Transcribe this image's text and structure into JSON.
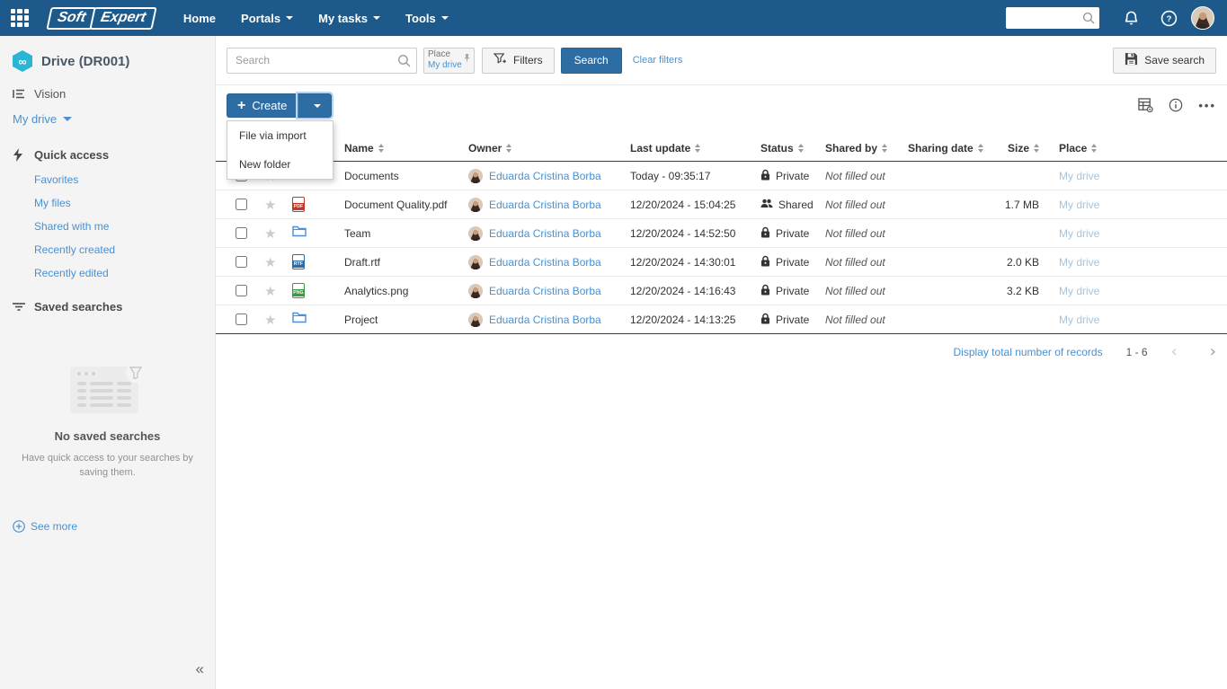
{
  "colors": {
    "navbar": "#1d5a8b",
    "primary": "#2e6da4",
    "link": "#4a90d2",
    "muted_place": "#a7c4dc",
    "pdf": "#c0392b",
    "rtf": "#2e6da4",
    "png": "#3d9944",
    "folder": "#4a90d2"
  },
  "navbar": {
    "logo": {
      "soft": "Soft",
      "expert": "Expert"
    },
    "menu": {
      "home": "Home",
      "portals": "Portals",
      "my_tasks": "My tasks",
      "tools": "Tools"
    },
    "search_value": ""
  },
  "sidebar": {
    "app_title": "Drive (DR001)",
    "app_icon_glyph": "∞",
    "vision": "Vision",
    "my_drive": "My drive",
    "quick_access": "Quick access",
    "links": {
      "favorites": "Favorites",
      "my_files": "My files",
      "shared_with_me": "Shared with me",
      "recently_created": "Recently created",
      "recently_edited": "Recently edited"
    },
    "saved_searches": "Saved searches",
    "empty_title": "No saved searches",
    "empty_text": "Have quick access to your searches by saving them.",
    "see_more": "See more",
    "collapse_glyph": "«"
  },
  "toolbar": {
    "search_placeholder": "Search",
    "place_label": "Place",
    "place_value": "My drive",
    "filters_label": "Filters",
    "search_button": "Search",
    "clear_filters": "Clear filters",
    "save_search": "Save search"
  },
  "create": {
    "label": "Create",
    "plus": "+",
    "menu": {
      "file_via_import": "File via import",
      "new_folder": "New folder"
    }
  },
  "table": {
    "columns": {
      "name": "Name",
      "owner": "Owner",
      "last_update": "Last update",
      "status": "Status",
      "shared_by": "Shared by",
      "sharing_date": "Sharing date",
      "size": "Size",
      "place": "Place"
    },
    "rows": [
      {
        "icon": {
          "kind": "folder"
        },
        "name": "Documents",
        "owner": "Eduarda Cristina Borba",
        "last_update": "Today - 09:35:17",
        "status": {
          "icon": "lock-icon",
          "label": "Private"
        },
        "shared_by": "Not filled out",
        "sharing_date": "",
        "size": "",
        "place": "My drive"
      },
      {
        "icon": {
          "kind": "file",
          "label": "PDF",
          "color": "#c0392b"
        },
        "name": "Document Quality.pdf",
        "owner": "Eduarda Cristina Borba",
        "last_update": "12/20/2024 - 15:04:25",
        "status": {
          "icon": "people-icon",
          "label": "Shared"
        },
        "shared_by": "Not filled out",
        "sharing_date": "",
        "size": "1.7 MB",
        "place": "My drive"
      },
      {
        "icon": {
          "kind": "folder"
        },
        "name": "Team",
        "owner": "Eduarda Cristina Borba",
        "last_update": "12/20/2024 - 14:52:50",
        "status": {
          "icon": "lock-icon",
          "label": "Private"
        },
        "shared_by": "Not filled out",
        "sharing_date": "",
        "size": "",
        "place": "My drive"
      },
      {
        "icon": {
          "kind": "file",
          "label": "RTF",
          "color": "#2e6da4"
        },
        "name": "Draft.rtf",
        "owner": "Eduarda Cristina Borba",
        "last_update": "12/20/2024 - 14:30:01",
        "status": {
          "icon": "lock-icon",
          "label": "Private"
        },
        "shared_by": "Not filled out",
        "sharing_date": "",
        "size": "2.0 KB",
        "place": "My drive"
      },
      {
        "icon": {
          "kind": "file",
          "label": "PNG",
          "color": "#3d9944"
        },
        "name": "Analytics.png",
        "owner": "Eduarda Cristina Borba",
        "last_update": "12/20/2024 - 14:16:43",
        "status": {
          "icon": "lock-icon",
          "label": "Private"
        },
        "shared_by": "Not filled out",
        "sharing_date": "",
        "size": "3.2 KB",
        "place": "My drive"
      },
      {
        "icon": {
          "kind": "folder"
        },
        "name": "Project",
        "owner": "Eduarda Cristina Borba",
        "last_update": "12/20/2024 - 14:13:25",
        "status": {
          "icon": "lock-icon",
          "label": "Private"
        },
        "shared_by": "Not filled out",
        "sharing_date": "",
        "size": "",
        "place": "My drive"
      }
    ]
  },
  "footer": {
    "display_total": "Display total number of records",
    "range": "1 - 6",
    "prev_glyph": "‹",
    "next_glyph": "›"
  }
}
